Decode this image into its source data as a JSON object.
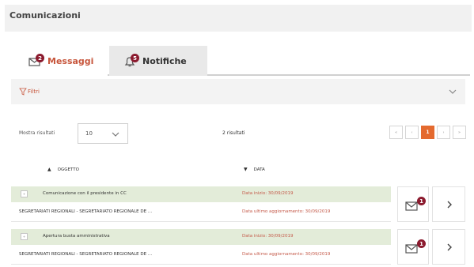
{
  "panel": {
    "title": "Comunicazioni"
  },
  "tabs": [
    {
      "label": "Messaggi",
      "badge": "2",
      "icon": "envelope-icon",
      "active": true
    },
    {
      "label": "Notifiche",
      "badge": "5",
      "icon": "bell-icon",
      "active": false
    }
  ],
  "filter": {
    "label": "Filtri",
    "icon": "filter-icon"
  },
  "results": {
    "show_label": "Mostra risultati",
    "page_size": "10",
    "count_label": "2 risultati"
  },
  "pagination": {
    "first": "«",
    "prev": "‹",
    "current": "1",
    "next": "›",
    "last": "»"
  },
  "columns": {
    "oggetto": "OGGETTO",
    "data": "DATA"
  },
  "messages": [
    {
      "subject": "Comunicazione con il presidente in CC",
      "sender": "SEGRETARIATI REGIONALI - SEGRETARIATO REGIONALE DE ...",
      "date_start": "Data inizio: 30/09/2019",
      "date_updated": "Data ultimo aggiornamento: 30/09/2019",
      "badge": "1"
    },
    {
      "subject": "Apertura busta amministrativa",
      "sender": "SEGRETARIATI REGIONALI - SEGRETARIATO REGIONALE DE ...",
      "date_start": "Data inizio: 30/09/2019",
      "date_updated": "Data ultimo aggiornamento: 30/09/2019",
      "badge": "1"
    }
  ],
  "colors": {
    "accent": "#c7553b",
    "badge": "#8b1a2e",
    "page_active": "#e46a2f",
    "row_highlight": "#e3ecd9"
  }
}
